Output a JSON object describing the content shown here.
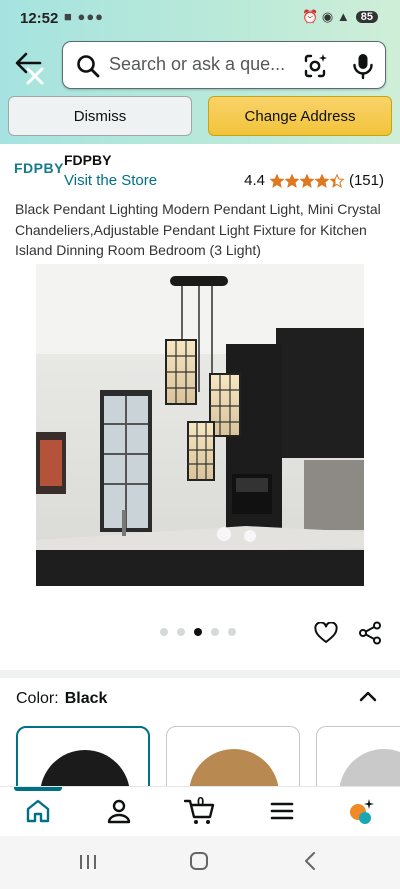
{
  "status_bar": {
    "time": "12:52",
    "notification_glyphs": "■ ●●●",
    "right_icons": "⏰ ◉ ▲",
    "battery": "85"
  },
  "search": {
    "placeholder": "Search or ask a que..."
  },
  "location_bar": {
    "dismiss_label": "Dismiss",
    "change_address_label": "Change Address"
  },
  "store": {
    "logo_text": "FDPBY",
    "brand_name": "FDPBY",
    "visit_store_label": "Visit the Store",
    "rating_value": "4.4",
    "rating_stars": 4.4,
    "review_count": "(151)"
  },
  "product": {
    "title": "Black Pendant Lighting Modern Pendant Light, Mini Crystal Chandeliers,Adjustable Pendant Light Fixture for Kitchen Island Dinning Room Bedroom (3 Light)"
  },
  "carousel": {
    "total_images": 5,
    "active_index": 2
  },
  "variant": {
    "label": "Color:",
    "selected_value": "Black",
    "swatch_colors": [
      "#1b1b1b",
      "#b88a52",
      "#c9c9c9"
    ]
  },
  "bottom_nav": {
    "cart_count": "0",
    "accent_color": "#007185"
  },
  "colors": {
    "link": "#007185",
    "star": "#de7921",
    "primary_button": "#f2c33a"
  }
}
